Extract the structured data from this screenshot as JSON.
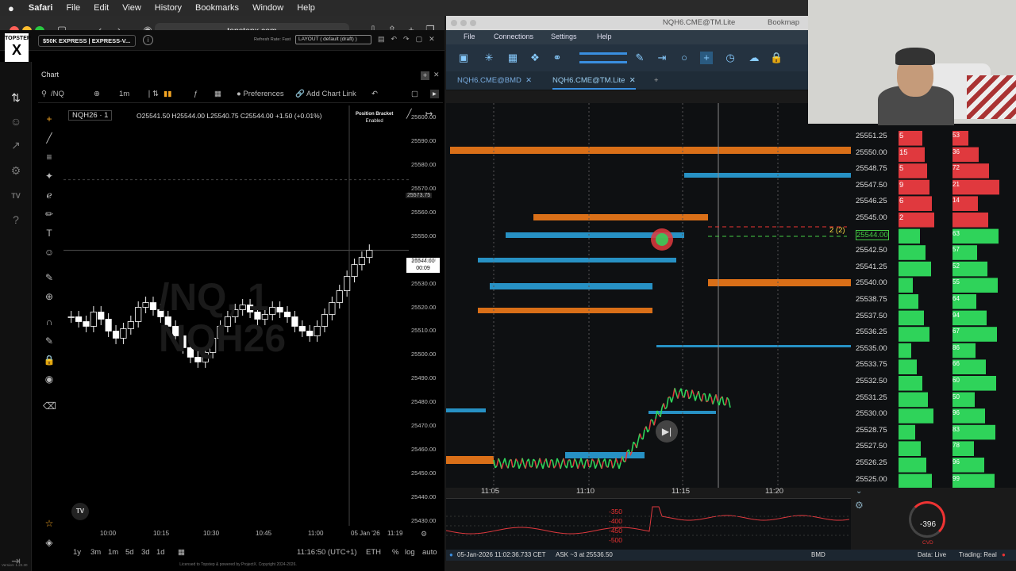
{
  "menubar": {
    "apple": "",
    "app": "Safari",
    "items": [
      "File",
      "Edit",
      "View",
      "History",
      "Bookmarks",
      "Window",
      "Help"
    ]
  },
  "safari": {
    "url": "topstepx.com"
  },
  "topstep": {
    "logo_top": "TOPSTEP",
    "logo_letter": "X",
    "account": "$50K EXPRESS | EXPRESS-V...",
    "refresh": "Refresh Rate: Fast",
    "layout": "LAYOUT ( default (draft) )",
    "chart_label": "Chart",
    "toolbar": {
      "symbol": "/NQ",
      "interval": "1m",
      "preferences": "Preferences",
      "add_link": "Add Chart Link"
    },
    "symbol_badge": "NQH26 · 1",
    "ohlc": "O25541.50  H25544.00  L25540.75  C25544.00  +1.50 (+0.01%)",
    "position_bracket": {
      "title": "Position Bracket",
      "status": "Enabled"
    },
    "watermark": [
      "/NQ, 1",
      "NQH26"
    ],
    "cursor_price": "25573.75",
    "last_price": "25544.00",
    "last_time": "00:09",
    "bottom": {
      "ranges": [
        "1y",
        "3m",
        "1m",
        "5d",
        "3d",
        "1d"
      ],
      "clock": "11:16:50 (UTC+1)",
      "session": "ETH",
      "pct": "%",
      "log": "log",
      "auto": "auto"
    },
    "footer": "Licensed to Topstep & powered by ProjectX. Copyright 2024-2026.",
    "version": "Version: 1.22.30",
    "tv": "TV"
  },
  "chart_data": {
    "type": "candlestick",
    "yticks": [
      25600,
      25590,
      25580,
      25570,
      25560,
      25550,
      25540,
      25530,
      25520,
      25510,
      25500,
      25490,
      25480,
      25470,
      25460,
      25450,
      25440,
      25430
    ],
    "ytick_labels": [
      "25600.00",
      "25590.00",
      "25580.00",
      "25570.00",
      "25560.00",
      "25550.00",
      "25540.00",
      "25530.00",
      "25520.00",
      "25510.00",
      "25500.00",
      "25490.00",
      "25480.00",
      "25470.00",
      "25460.00",
      "25450.00",
      "25440.00",
      "25430.00"
    ],
    "xticks": [
      "10:00",
      "10:15",
      "10:30",
      "10:45",
      "11:00",
      "05 Jan '26",
      "11:19"
    ],
    "ylim": [
      25428,
      25605
    ],
    "close_series": [
      25516,
      25514,
      25512,
      25518,
      25515,
      25510,
      25507,
      25511,
      25514,
      25520,
      25522,
      25519,
      25516,
      25512,
      25508,
      25503,
      25499,
      25497,
      25501,
      25507,
      25512,
      25516,
      25519,
      25521,
      25518,
      25515,
      25517,
      25520,
      25518,
      25516,
      25512,
      25510,
      25508,
      25512,
      25517,
      25522,
      25527,
      25533,
      25538,
      25541,
      25544
    ]
  },
  "bookmap": {
    "title": "NQH6.CME@TM.Lite",
    "title_app": "Bookmap",
    "menu": [
      "File",
      "Connections",
      "Settings",
      "Help"
    ],
    "tabs": [
      "NQH6.CME@BMD",
      "NQH6.CME@TM.Lite"
    ],
    "add_tab": "+",
    "prices": [
      "25551.25",
      "25550.00",
      "25548.75",
      "25547.50",
      "25546.25",
      "25545.00",
      "25544.00",
      "25542.50",
      "25541.25",
      "25540.00",
      "25538.75",
      "25537.50",
      "25536.25",
      "25535.00",
      "25533.75",
      "25532.50",
      "25531.25",
      "25530.00",
      "25528.75",
      "25527.50",
      "25526.25",
      "25525.00"
    ],
    "bid_sizes": [
      "5",
      "15",
      "5",
      "9",
      "6",
      "2",
      "",
      "",
      "",
      "",
      "",
      "",
      "",
      "",
      "",
      "",
      "",
      "",
      "",
      "",
      "",
      ""
    ],
    "right_sizes": [
      "53",
      "36",
      "72",
      "21",
      "14",
      "",
      "63",
      "57",
      "52",
      "55",
      "64",
      "94",
      "67",
      "86",
      "66",
      "60",
      "50",
      "96",
      "83",
      "78",
      "96",
      "99"
    ],
    "pos_label": "2 (2)",
    "times": [
      "11:05",
      "11:10",
      "11:15",
      "11:20"
    ],
    "cvd_ticks": [
      "-350",
      "-400",
      "-450",
      "-500"
    ],
    "cvd_value": "-396",
    "cvd_label": "CVD",
    "status": {
      "time": "05-Jan-2026 11:02:36.733 CET",
      "ask": "ASK ~3 at 25536.50",
      "feed": "BMD",
      "data": "Data: Live",
      "trading": "Trading: Real"
    }
  },
  "colors": {
    "bid": "#2fd35a",
    "ask": "#e0393e",
    "liquidity_orange": "#f07a1a",
    "liquidity_blue": "#2aa0d8"
  }
}
